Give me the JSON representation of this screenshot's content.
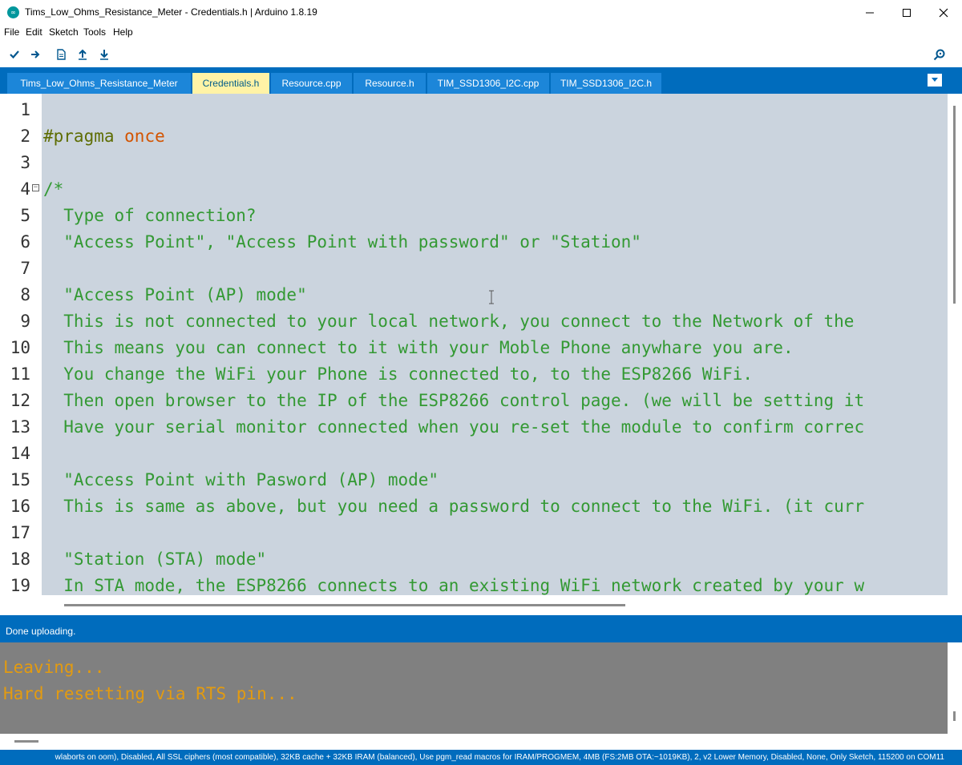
{
  "window": {
    "title": "Tims_Low_Ohms_Resistance_Meter - Credentials.h | Arduino 1.8.19",
    "logo_icon": "arduino-logo-icon",
    "logo_glyph": "∞",
    "minimize_glyph": "—",
    "maximize_glyph": "☐",
    "close_glyph": "✕"
  },
  "menu": {
    "file": "File",
    "edit": "Edit",
    "sketch": "Sketch",
    "tools": "Tools",
    "help": "Help"
  },
  "toolbar": {
    "icons": [
      "verify-check-icon",
      "upload-arrow-icon",
      "new-file-icon",
      "open-arrow-up-icon",
      "save-arrow-down-icon",
      "serial-monitor-icon"
    ]
  },
  "tabs": [
    {
      "label": "Tims_Low_Ohms_Resistance_Meter",
      "active": false
    },
    {
      "label": "Credentials.h",
      "active": true
    },
    {
      "label": "Resource.cpp",
      "active": false
    },
    {
      "label": "Resource.h",
      "active": false
    },
    {
      "label": "TIM_SSD1306_I2C.cpp",
      "active": false
    },
    {
      "label": "TIM_SSD1306_I2C.h",
      "active": false
    }
  ],
  "editor": {
    "line_numbers": [
      "1",
      "2",
      "3",
      "4",
      "5",
      "6",
      "7",
      "8",
      "9",
      "10",
      "11",
      "12",
      "13",
      "14",
      "15",
      "16",
      "17",
      "18",
      "19"
    ],
    "pragma_keyword": "#pragma",
    "pragma_value": "once",
    "lines": [
      "",
      "#pragma once",
      "",
      "/*",
      "  Type of connection?",
      "  \"Access Point\", \"Access Point with password\" or \"Station\"",
      "",
      "  \"Access Point (AP) mode\"",
      "  This is not connected to your local network, you connect to the Network of the",
      "  This means you can connect to it with your Moble Phone anywhare you are.",
      "  You change the WiFi your Phone is connected to, to the ESP8266 WiFi.",
      "  Then open browser to the IP of the ESP8266 control page. (we will be setting it",
      "  Have your serial monitor connected when you re-set the module to confirm correc",
      "",
      "  \"Access Point with Pasword (AP) mode\"",
      "  This is same as above, but you need a password to connect to the WiFi. (it curr",
      "",
      "  \"Station (STA) mode\"",
      "  In STA mode, the ESP8266 connects to an existing WiFi network created by your w"
    ],
    "colors": {
      "comment": "#339933",
      "keyword": "#5e6d03",
      "keyword_value": "#d35400",
      "selection": "#cbd4de"
    }
  },
  "status": {
    "message": "Done uploading."
  },
  "console": {
    "lines": [
      "Leaving...",
      "Hard resetting via RTS pin..."
    ]
  },
  "footer": {
    "board_info": "wlaborts on oom), Disabled, All SSL ciphers (most compatible), 32KB cache + 32KB IRAM (balanced), Use pgm_read macros for IRAM/PROGMEM, 4MB (FS:2MB OTA:~1019KB), 2, v2 Lower Memory, Disabled, None, Only Sketch, 115200 on COM11"
  }
}
